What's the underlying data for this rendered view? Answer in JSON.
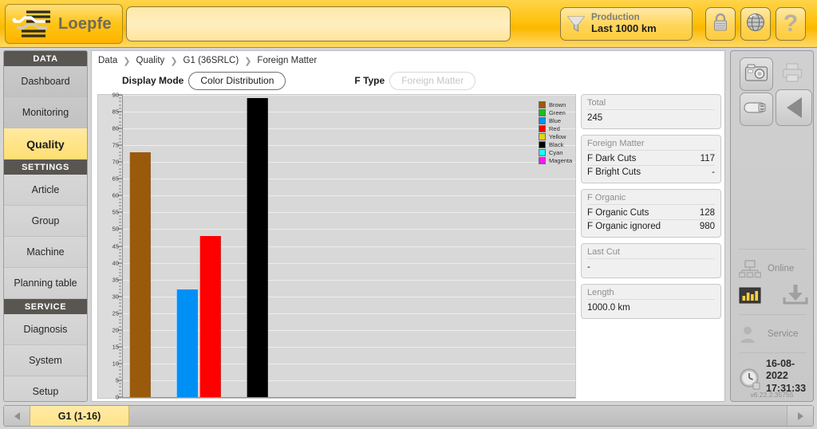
{
  "header": {
    "brand": "Loepfe",
    "logo_icon": "loepfe-yarn-logo",
    "search_value": "",
    "search_placeholder": "",
    "production": {
      "icon": "funnel-icon",
      "label": "Production",
      "value": "Last 1000 km"
    },
    "buttons": [
      {
        "name": "lock-button",
        "icon": "lock-icon"
      },
      {
        "name": "language-button",
        "icon": "globe-icon"
      },
      {
        "name": "help-button",
        "icon": "question-mark-icon",
        "glyph": "?"
      }
    ]
  },
  "sidebar": {
    "groups": [
      {
        "title": "DATA",
        "items": [
          {
            "label": "Dashboard",
            "active": false
          },
          {
            "label": "Monitoring",
            "active": false
          },
          {
            "label": "Quality",
            "active": true
          }
        ]
      },
      {
        "title": "SETTINGS",
        "items": [
          {
            "label": "Article",
            "active": false
          },
          {
            "label": "Group",
            "active": false
          },
          {
            "label": "Machine",
            "active": false
          },
          {
            "label": "Planning table",
            "active": false
          }
        ]
      },
      {
        "title": "SERVICE",
        "items": [
          {
            "label": "Diagnosis",
            "active": false
          },
          {
            "label": "System",
            "active": false
          },
          {
            "label": "Setup",
            "active": false
          }
        ]
      }
    ]
  },
  "breadcrumb": [
    "Data",
    "Quality",
    "G1 (36SRLC)",
    "Foreign Matter"
  ],
  "toolbar": {
    "display_mode_label": "Display Mode",
    "display_mode_value": "Color Distribution",
    "f_type_label": "F Type",
    "f_type_value": "Foreign Matter"
  },
  "chart_data": {
    "type": "bar",
    "title": "",
    "xlabel": "",
    "ylabel": "",
    "ylim": [
      0,
      90
    ],
    "ytick_step": 5,
    "yticks": [
      0,
      5,
      10,
      15,
      20,
      25,
      30,
      35,
      40,
      45,
      50,
      55,
      60,
      65,
      70,
      75,
      80,
      85,
      90
    ],
    "grid": true,
    "legend_position": "right",
    "categories": [
      "Brown",
      "Green",
      "Blue",
      "Red",
      "Yellow",
      "Black",
      "Cyan",
      "Magenta"
    ],
    "values": [
      73,
      0,
      32,
      48,
      0,
      89,
      0,
      0
    ],
    "colors": [
      "#9a5a0c",
      "#17bf1a",
      "#0090f5",
      "#fe0000",
      "#e2d416",
      "#000000",
      "#19ffff",
      "#ff17ff"
    ],
    "legend": [
      {
        "label": "Brown",
        "color": "#9a5a0c"
      },
      {
        "label": "Green",
        "color": "#17bf1a"
      },
      {
        "label": "Blue",
        "color": "#0090f5"
      },
      {
        "label": "Red",
        "color": "#fe0000"
      },
      {
        "label": "Yellow",
        "color": "#e2d416"
      },
      {
        "label": "Black",
        "color": "#000000"
      },
      {
        "label": "Cyan",
        "color": "#19ffff"
      },
      {
        "label": "Magenta",
        "color": "#ff17ff"
      }
    ]
  },
  "stats": {
    "total": {
      "title": "Total",
      "value": "245"
    },
    "foreign_matter": {
      "title": "Foreign Matter",
      "rows": [
        {
          "key": "F Dark Cuts",
          "value": "117"
        },
        {
          "key": "F Bright Cuts",
          "value": "-"
        }
      ]
    },
    "f_organic": {
      "title": "F Organic",
      "rows": [
        {
          "key": "F Organic Cuts",
          "value": "128"
        },
        {
          "key": "F Organic ignored",
          "value": "980"
        }
      ]
    },
    "last_cut": {
      "title": "Last Cut",
      "value": "-"
    },
    "length": {
      "title": "Length",
      "value": "1000.0 km"
    }
  },
  "rail": {
    "buttons": [
      {
        "name": "screenshot-button",
        "icon": "camera-icon"
      },
      {
        "name": "print-button",
        "icon": "printer-icon"
      },
      {
        "name": "usb-export-button",
        "icon": "usb-stick-icon"
      },
      {
        "name": "back-button",
        "icon": "triangle-left-icon"
      }
    ],
    "status": [
      {
        "icon": "network-icon",
        "label": "Online"
      },
      {
        "icon": "user-icon",
        "label": "Service"
      }
    ],
    "chart_toggle_icon": "bar-chart-icon",
    "download_icon": "download-tray-icon",
    "clock_icon": "clock-icon",
    "date": "16-08-2022",
    "time": "17:31:33",
    "version": "v6.22.2.35755"
  },
  "bottom": {
    "prev_icon": "chevron-left-icon",
    "next_icon": "chevron-right-icon",
    "tabs": [
      {
        "label": "G1 (1-16)",
        "active": true
      }
    ]
  },
  "colors": {
    "brand_yellow": "#ffc20e",
    "active_yellow": "#ffe488",
    "group_header": "#595652"
  }
}
